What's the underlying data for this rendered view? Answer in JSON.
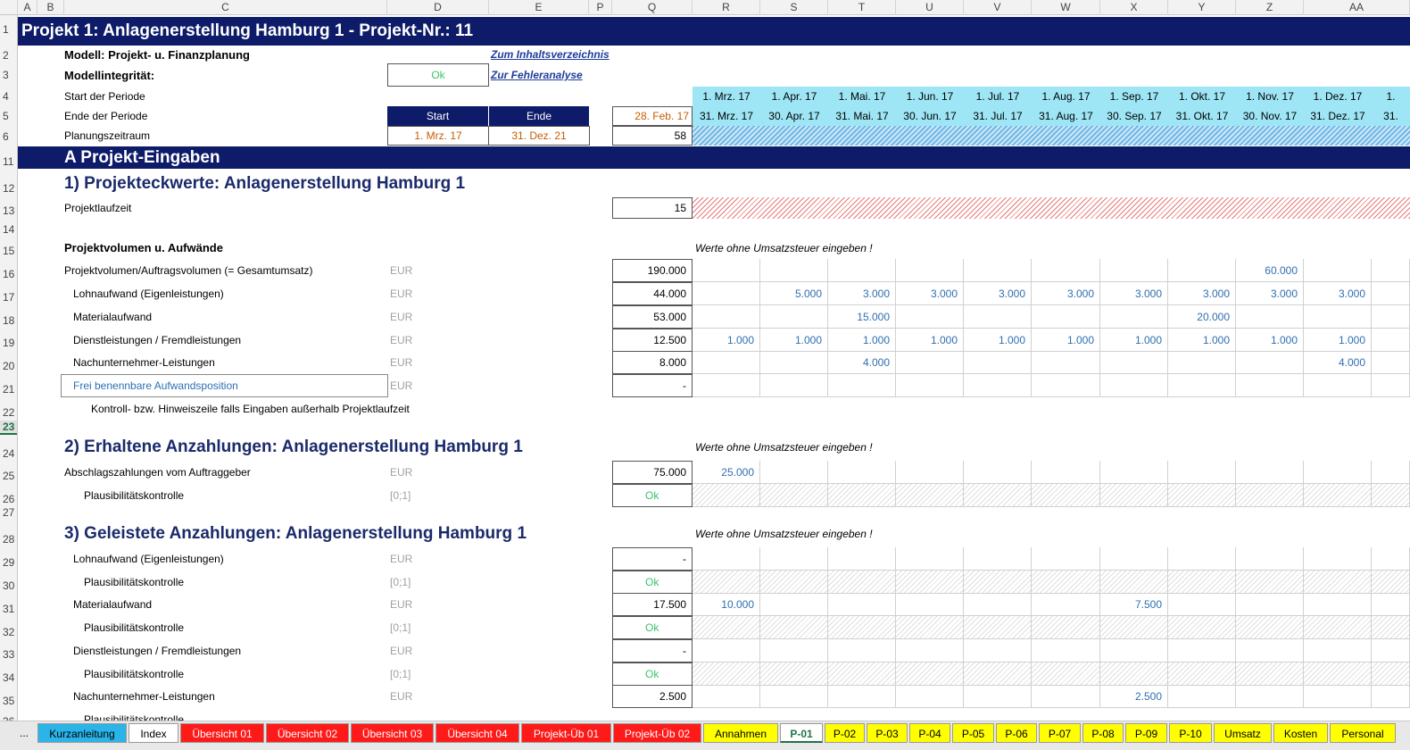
{
  "columns": [
    "A",
    "B",
    "C",
    "D",
    "E",
    "P",
    "Q",
    "R",
    "S",
    "T",
    "U",
    "V",
    "W",
    "X",
    "Y",
    "Z",
    "AA"
  ],
  "rows": [
    "1",
    "2",
    "3",
    "4",
    "5",
    "6",
    "11",
    "12",
    "13",
    "14",
    "15",
    "16",
    "17",
    "18",
    "19",
    "20",
    "21",
    "22",
    "23",
    "24",
    "25",
    "26",
    "27",
    "28",
    "29",
    "30",
    "31",
    "32",
    "33",
    "34",
    "35",
    "36"
  ],
  "title": "Projekt 1: Anlagenerstellung Hamburg 1 - Projekt-Nr.: 11",
  "modell": "Modell: Projekt- u. Finanzplanung",
  "modellintegritaet": "Modellintegrität:",
  "integrity_value": "Ok",
  "link_index": "Zum Inhaltsverzeichnis",
  "link_errors": "Zur Fehleranalyse",
  "start_periode": "Start der Periode",
  "ende_periode": "Ende der Periode",
  "planungszeitraum": "Planungszeitraum",
  "start_label": "Start",
  "ende_label": "Ende",
  "start_date": "1. Mrz. 17",
  "end_date": "31. Dez. 21",
  "prev_end": "28. Feb. 17",
  "periods": "58",
  "period_starts": [
    "1. Mrz. 17",
    "1. Apr. 17",
    "1. Mai. 17",
    "1. Jun. 17",
    "1. Jul. 17",
    "1. Aug. 17",
    "1. Sep. 17",
    "1. Okt. 17",
    "1. Nov. 17",
    "1. Dez. 17",
    "1."
  ],
  "period_ends": [
    "31. Mrz. 17",
    "30. Apr. 17",
    "31. Mai. 17",
    "30. Jun. 17",
    "31. Jul. 17",
    "31. Aug. 17",
    "30. Sep. 17",
    "31. Okt. 17",
    "30. Nov. 17",
    "31. Dez. 17",
    "31."
  ],
  "section_a": "A  Projekt-Eingaben",
  "h1": "1) Projekteckwerte: Anlagenerstellung Hamburg 1",
  "projektlaufzeit": "Projektlaufzeit",
  "laufzeit_value": "15",
  "projektvolumen_hdr": "Projektvolumen u. Aufwände",
  "note": "Werte ohne Umsatzsteuer eingeben !",
  "eur": "EUR",
  "range": "[0;1]",
  "plaus": "Plausibilitätskontrolle",
  "kontrollzeile": "Kontroll- bzw. Hinweiszeile falls Eingaben außerhalb Projektlaufzeit",
  "sec1_rows": [
    {
      "label": "Projektvolumen/Auftragsvolumen (= Gesamtumsatz)",
      "total": "190.000",
      "vals": [
        "",
        "",
        "",
        "",
        "",
        "",
        "",
        "",
        "60.000",
        ""
      ],
      "indent": false
    },
    {
      "label": "Lohnaufwand (Eigenleistungen)",
      "total": "44.000",
      "vals": [
        "",
        "5.000",
        "3.000",
        "3.000",
        "3.000",
        "3.000",
        "3.000",
        "3.000",
        "3.000",
        "3.000"
      ],
      "indent": true
    },
    {
      "label": "Materialaufwand",
      "total": "53.000",
      "vals": [
        "",
        "",
        "15.000",
        "",
        "",
        "",
        "",
        "20.000",
        "",
        ""
      ],
      "indent": true
    },
    {
      "label": "Dienstleistungen / Fremdleistungen",
      "total": "12.500",
      "vals": [
        "1.000",
        "1.000",
        "1.000",
        "1.000",
        "1.000",
        "1.000",
        "1.000",
        "1.000",
        "1.000",
        "1.000"
      ],
      "indent": true
    },
    {
      "label": "Nachunternehmer-Leistungen",
      "total": "8.000",
      "vals": [
        "",
        "",
        "4.000",
        "",
        "",
        "",
        "",
        "",
        "",
        "4.000"
      ],
      "indent": true
    },
    {
      "label": "Frei benennbare Aufwandsposition",
      "total": "-",
      "vals": [
        "",
        "",
        "",
        "",
        "",
        "",
        "",
        "",
        "",
        ""
      ],
      "indent": true
    }
  ],
  "h2": "2) Erhaltene Anzahlungen: Anlagenerstellung Hamburg 1",
  "abschlag": "Abschlagszahlungen vom Auftraggeber",
  "abschlag_total": "75.000",
  "abschlag_first": "25.000",
  "h3": "3) Geleistete Anzahlungen: Anlagenerstellung Hamburg 1",
  "sec3": [
    {
      "label": "Lohnaufwand (Eigenleistungen)",
      "total": "-",
      "r": "",
      "x": ""
    },
    {
      "label": "Materialaufwand",
      "total": "17.500",
      "r": "10.000",
      "x": "7.500"
    },
    {
      "label": "Dienstleistungen / Fremdleistungen",
      "total": "-",
      "r": "",
      "x": ""
    },
    {
      "label": "Nachunternehmer-Leistungen",
      "total": "2.500",
      "r": "",
      "x": "2.500"
    }
  ],
  "plaus_partial": "Plausibilitätskontrolle",
  "tabs": [
    {
      "label": "...",
      "color": "#e8e8e8"
    },
    {
      "label": "Kurzanleitung",
      "color": "#2ab4e8"
    },
    {
      "label": "Index",
      "color": "#ffffff"
    },
    {
      "label": "Übersicht 01",
      "color": "#ff1a1a"
    },
    {
      "label": "Übersicht 02",
      "color": "#ff1a1a"
    },
    {
      "label": "Übersicht 03",
      "color": "#ff1a1a"
    },
    {
      "label": "Übersicht 04",
      "color": "#ff1a1a"
    },
    {
      "label": "Projekt-Üb 01",
      "color": "#ff1a1a"
    },
    {
      "label": "Projekt-Üb 02",
      "color": "#ff1a1a"
    },
    {
      "label": "Annahmen",
      "color": "#ffff00"
    },
    {
      "label": "P-01",
      "color": "#ffffff"
    },
    {
      "label": "P-02",
      "color": "#ffff00"
    },
    {
      "label": "P-03",
      "color": "#ffff00"
    },
    {
      "label": "P-04",
      "color": "#ffff00"
    },
    {
      "label": "P-05",
      "color": "#ffff00"
    },
    {
      "label": "P-06",
      "color": "#ffff00"
    },
    {
      "label": "P-07",
      "color": "#ffff00"
    },
    {
      "label": "P-08",
      "color": "#ffff00"
    },
    {
      "label": "P-09",
      "color": "#ffff00"
    },
    {
      "label": "P-10",
      "color": "#ffff00"
    },
    {
      "label": "Umsatz",
      "color": "#ffff00"
    },
    {
      "label": "Kosten",
      "color": "#ffff00"
    },
    {
      "label": "Personal",
      "color": "#ffff00"
    }
  ]
}
